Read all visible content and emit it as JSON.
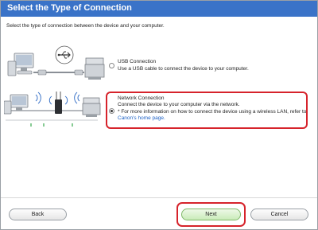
{
  "header": {
    "title": "Select the Type of Connection"
  },
  "subtitle": "Select the type of connection between the device and your computer.",
  "options": [
    {
      "title": "USB Connection",
      "description": "Use a USB cable to connect the device to your computer.",
      "selected": false
    },
    {
      "title": "Network Connection",
      "description": "Connect the device to your computer via the network.",
      "note": "* For more information on how to connect the device using a wireless LAN, refer to",
      "link": "Canon's home page.",
      "selected": true
    }
  ],
  "buttons": {
    "back": "Back",
    "next": "Next",
    "cancel": "Cancel"
  },
  "colors": {
    "header_bg": "#3a73c8",
    "highlight": "#d6232b",
    "link": "#1a5fc4"
  },
  "icons": {
    "usb": "usb-icon",
    "wifi": "wifi-icon"
  }
}
